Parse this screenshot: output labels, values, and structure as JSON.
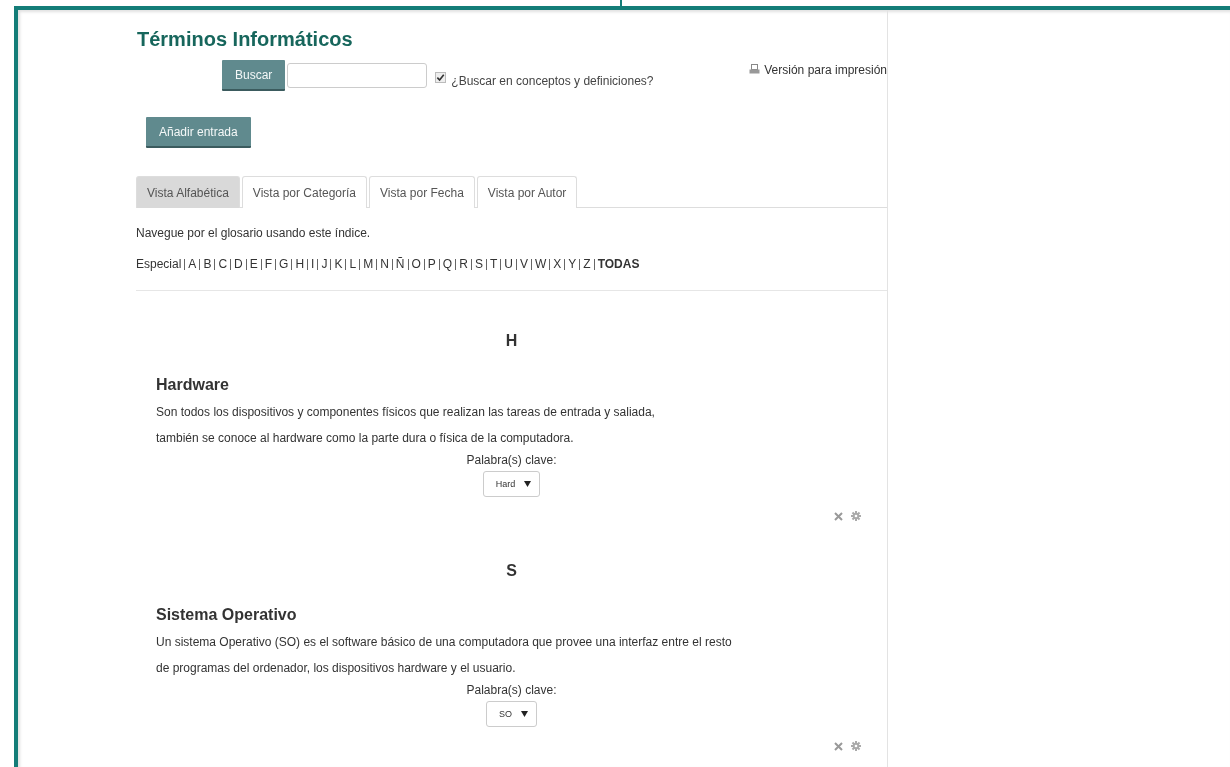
{
  "title": "Términos Informáticos",
  "search": {
    "button": "Buscar",
    "option": {
      "label": "¿Buscar en conceptos y definiciones?",
      "checked": true
    }
  },
  "print_link": "Versión para impresión",
  "add_button": "Añadir entrada",
  "tabs": [
    {
      "label": "Vista Alfabética",
      "selected": true
    },
    {
      "label": "Vista por Categoría",
      "selected": false
    },
    {
      "label": "Vista por Fecha",
      "selected": false
    },
    {
      "label": "Vista por Autor",
      "selected": false
    }
  ],
  "intro": "Navegue por el glosario usando este índice.",
  "index": [
    {
      "label": "Especial",
      "selected": false
    },
    {
      "label": "A",
      "selected": false
    },
    {
      "label": "B",
      "selected": false
    },
    {
      "label": "C",
      "selected": false
    },
    {
      "label": "D",
      "selected": false
    },
    {
      "label": "E",
      "selected": false
    },
    {
      "label": "F",
      "selected": false
    },
    {
      "label": "G",
      "selected": false
    },
    {
      "label": "H",
      "selected": false
    },
    {
      "label": "I",
      "selected": false
    },
    {
      "label": "J",
      "selected": false
    },
    {
      "label": "K",
      "selected": false
    },
    {
      "label": "L",
      "selected": false
    },
    {
      "label": "M",
      "selected": false
    },
    {
      "label": "N",
      "selected": false
    },
    {
      "label": "Ñ",
      "selected": false
    },
    {
      "label": "O",
      "selected": false
    },
    {
      "label": "P",
      "selected": false
    },
    {
      "label": "Q",
      "selected": false
    },
    {
      "label": "R",
      "selected": false
    },
    {
      "label": "S",
      "selected": false
    },
    {
      "label": "T",
      "selected": false
    },
    {
      "label": "U",
      "selected": false
    },
    {
      "label": "V",
      "selected": false
    },
    {
      "label": "W",
      "selected": false
    },
    {
      "label": "X",
      "selected": false
    },
    {
      "label": "Y",
      "selected": false
    },
    {
      "label": "Z",
      "selected": false
    },
    {
      "label": "TODAS",
      "selected": true
    }
  ],
  "groups": [
    {
      "letter": "H",
      "entries": [
        {
          "term": "Hardware",
          "definition": [
            "Son todos los dispositivos y componentes físicos que realizan las tareas de entrada y saliada,",
            "también se conoce al hardware como la parte dura o física de la computadora."
          ],
          "keywords_label": "Palabra(s) clave:",
          "keyword": "Hard"
        }
      ]
    },
    {
      "letter": "S",
      "entries": [
        {
          "term": "Sistema Operativo",
          "definition": [
            "Un sistema Operativo (SO) es el software básico de una computadora que provee una interfaz entre el resto",
            "de programas del ordenador, los dispositivos hardware y el usuario."
          ],
          "keywords_label": "Palabra(s) clave:",
          "keyword": "SO"
        }
      ]
    }
  ]
}
